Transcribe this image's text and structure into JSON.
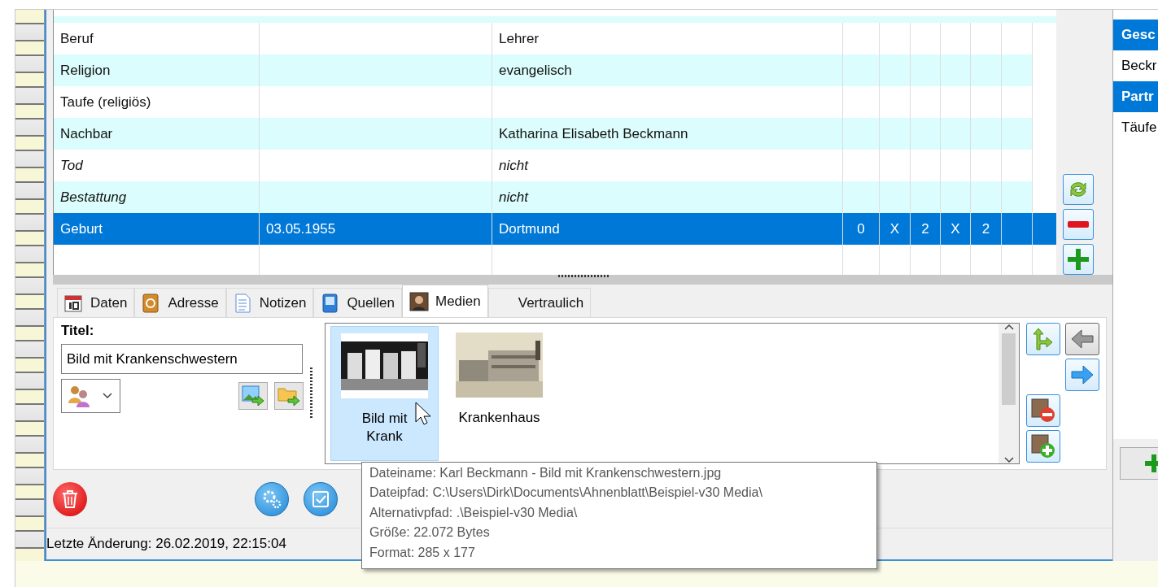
{
  "table": {
    "rows": [
      {
        "event": "Beruf",
        "date": "",
        "value": "Lehrer",
        "italic": false,
        "selected": false,
        "flags": []
      },
      {
        "event": "Religion",
        "date": "",
        "value": "evangelisch",
        "italic": false,
        "selected": false,
        "flags": []
      },
      {
        "event": "Taufe (religiös)",
        "date": "",
        "value": "",
        "italic": false,
        "selected": false,
        "flags": []
      },
      {
        "event": "Nachbar",
        "date": "",
        "value": "Katharina Elisabeth Beckmann",
        "italic": false,
        "selected": false,
        "flags": []
      },
      {
        "event": "Tod",
        "date": "",
        "value": "nicht",
        "italic": true,
        "selected": false,
        "flags": []
      },
      {
        "event": "Bestattung",
        "date": "",
        "value": "nicht",
        "italic": true,
        "selected": false,
        "flags": []
      },
      {
        "event": "Geburt",
        "date": "03.05.1955",
        "value": "Dortmund",
        "italic": false,
        "selected": true,
        "flags": [
          "0",
          "X",
          "2",
          "X",
          "2"
        ]
      }
    ]
  },
  "tabs": [
    {
      "label": "Daten",
      "selected": false
    },
    {
      "label": "Adresse",
      "selected": false
    },
    {
      "label": "Notizen",
      "selected": false
    },
    {
      "label": "Quellen",
      "selected": false
    },
    {
      "label": "Medien",
      "selected": true
    },
    {
      "label": "Vertraulich",
      "selected": false
    }
  ],
  "media": {
    "title_label": "Titel:",
    "title_value": "Bild mit Krankenschwestern",
    "items": [
      {
        "caption": "Bild mit Krank",
        "selected": true,
        "kind": "picture"
      },
      {
        "caption": "Krankenhaus",
        "selected": false,
        "kind": "picture"
      }
    ]
  },
  "tooltip": [
    "Dateiname: Karl Beckmann - Bild mit Krankenschwestern.jpg",
    "Dateipfad: C:\\Users\\Dirk\\Documents\\Ahnenblatt\\Beispiel-v30 Media\\",
    "Alternativpfad: .\\Beispiel-v30 Media\\",
    "Größe: 22.072 Bytes",
    "Format: 285 x 177"
  ],
  "status_bar": "Letzte Änderung: 26.02.2019, 22:15:04",
  "side_panel": [
    {
      "text": "Gesc",
      "kind": "header"
    },
    {
      "text": "Beckr",
      "kind": "entry"
    },
    {
      "text": "Partr",
      "kind": "header"
    },
    {
      "text": "Täufe",
      "kind": "entry"
    }
  ]
}
